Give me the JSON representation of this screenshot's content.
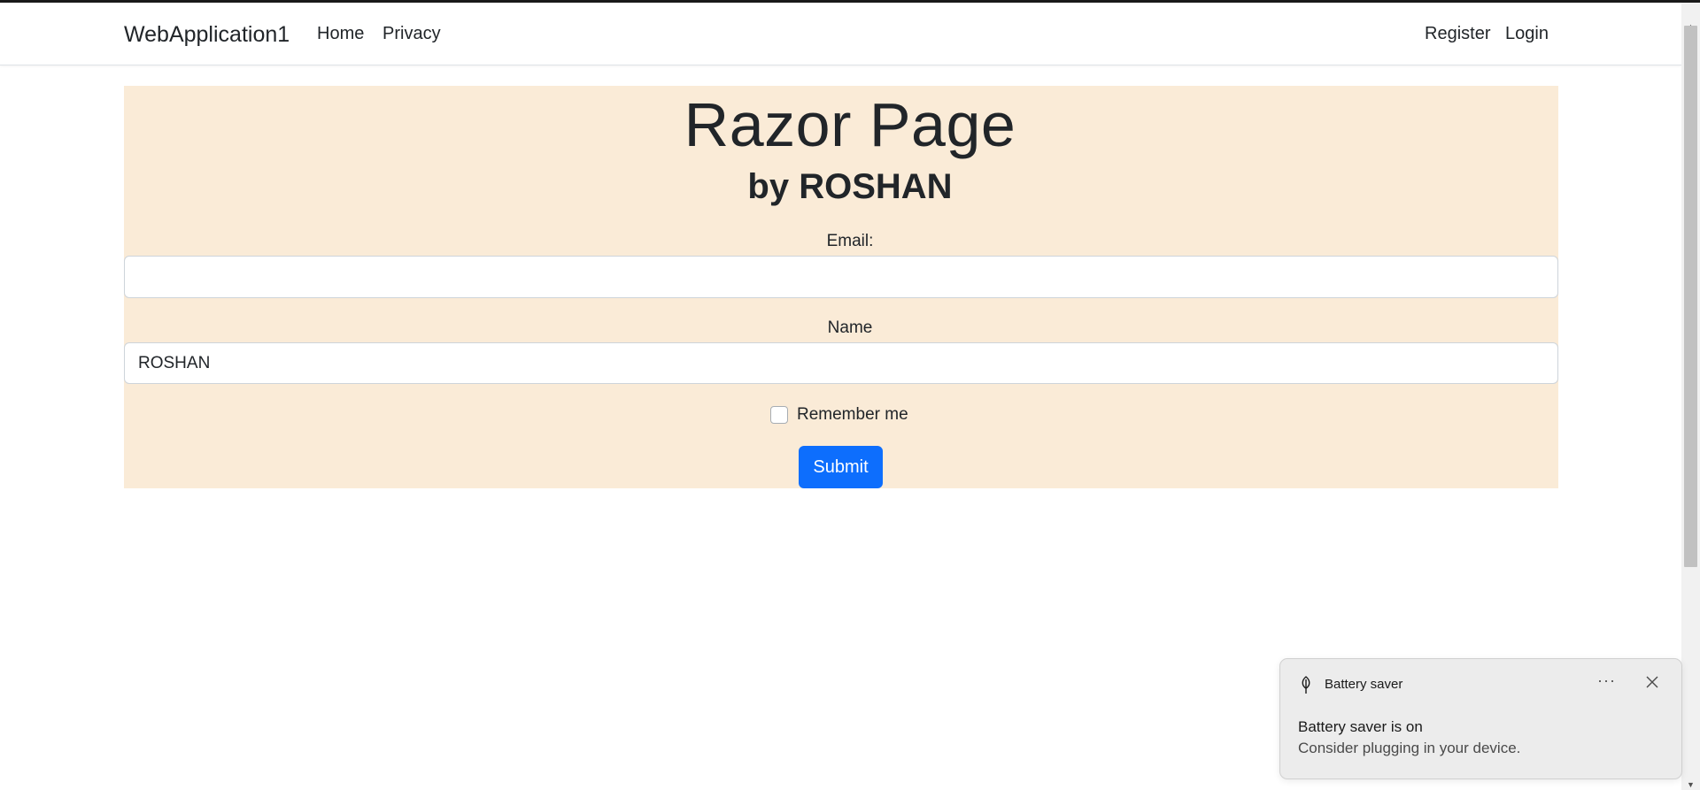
{
  "navbar": {
    "brand": "WebApplication1",
    "links": [
      {
        "label": "Home"
      },
      {
        "label": "Privacy"
      }
    ],
    "right_links": [
      {
        "label": "Register"
      },
      {
        "label": "Login"
      }
    ]
  },
  "main": {
    "title": "Razor Page",
    "subtitle": "by ROSHAN",
    "email_label": "Email:",
    "email_value": "",
    "name_label": "Name",
    "name_value": "ROSHAN",
    "remember_label": "Remember me",
    "remember_checked": false,
    "submit_label": "Submit",
    "background_color": "#faebd7",
    "accent_color": "#0d6efd"
  },
  "toast": {
    "app_name": "Battery saver",
    "icon": "leaf-icon",
    "more_label": "···",
    "title": "Battery saver is on",
    "body": "Consider plugging in your device."
  }
}
